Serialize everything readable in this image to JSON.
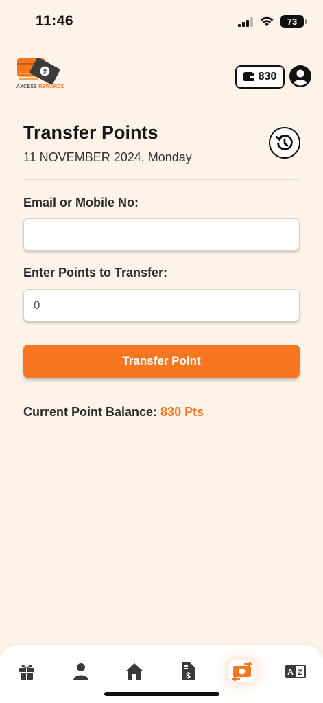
{
  "status_bar": {
    "time": "11:46",
    "battery": "73"
  },
  "header": {
    "logo_text_main": "AXCESS",
    "logo_text_accent": "REWARDS",
    "wallet_points": "830"
  },
  "page": {
    "title": "Transfer Points",
    "date": "11 NOVEMBER 2024, Monday"
  },
  "form": {
    "email_label": "Email or Mobile No:",
    "email_value": "",
    "points_label": "Enter Points to Transfer:",
    "points_value": "0",
    "submit_label": "Transfer Point"
  },
  "balance": {
    "label": "Current Point Balance:",
    "value": "830 Pts"
  },
  "bottom_nav": [
    {
      "icon": "gift-icon",
      "active": false
    },
    {
      "icon": "user-icon",
      "active": false
    },
    {
      "icon": "home-icon",
      "active": false
    },
    {
      "icon": "invoice-icon",
      "active": false
    },
    {
      "icon": "transfer-money-icon",
      "active": true
    },
    {
      "icon": "language-icon",
      "active": false
    }
  ],
  "colors": {
    "accent": "#f7761f",
    "background": "#fdf3e8"
  }
}
